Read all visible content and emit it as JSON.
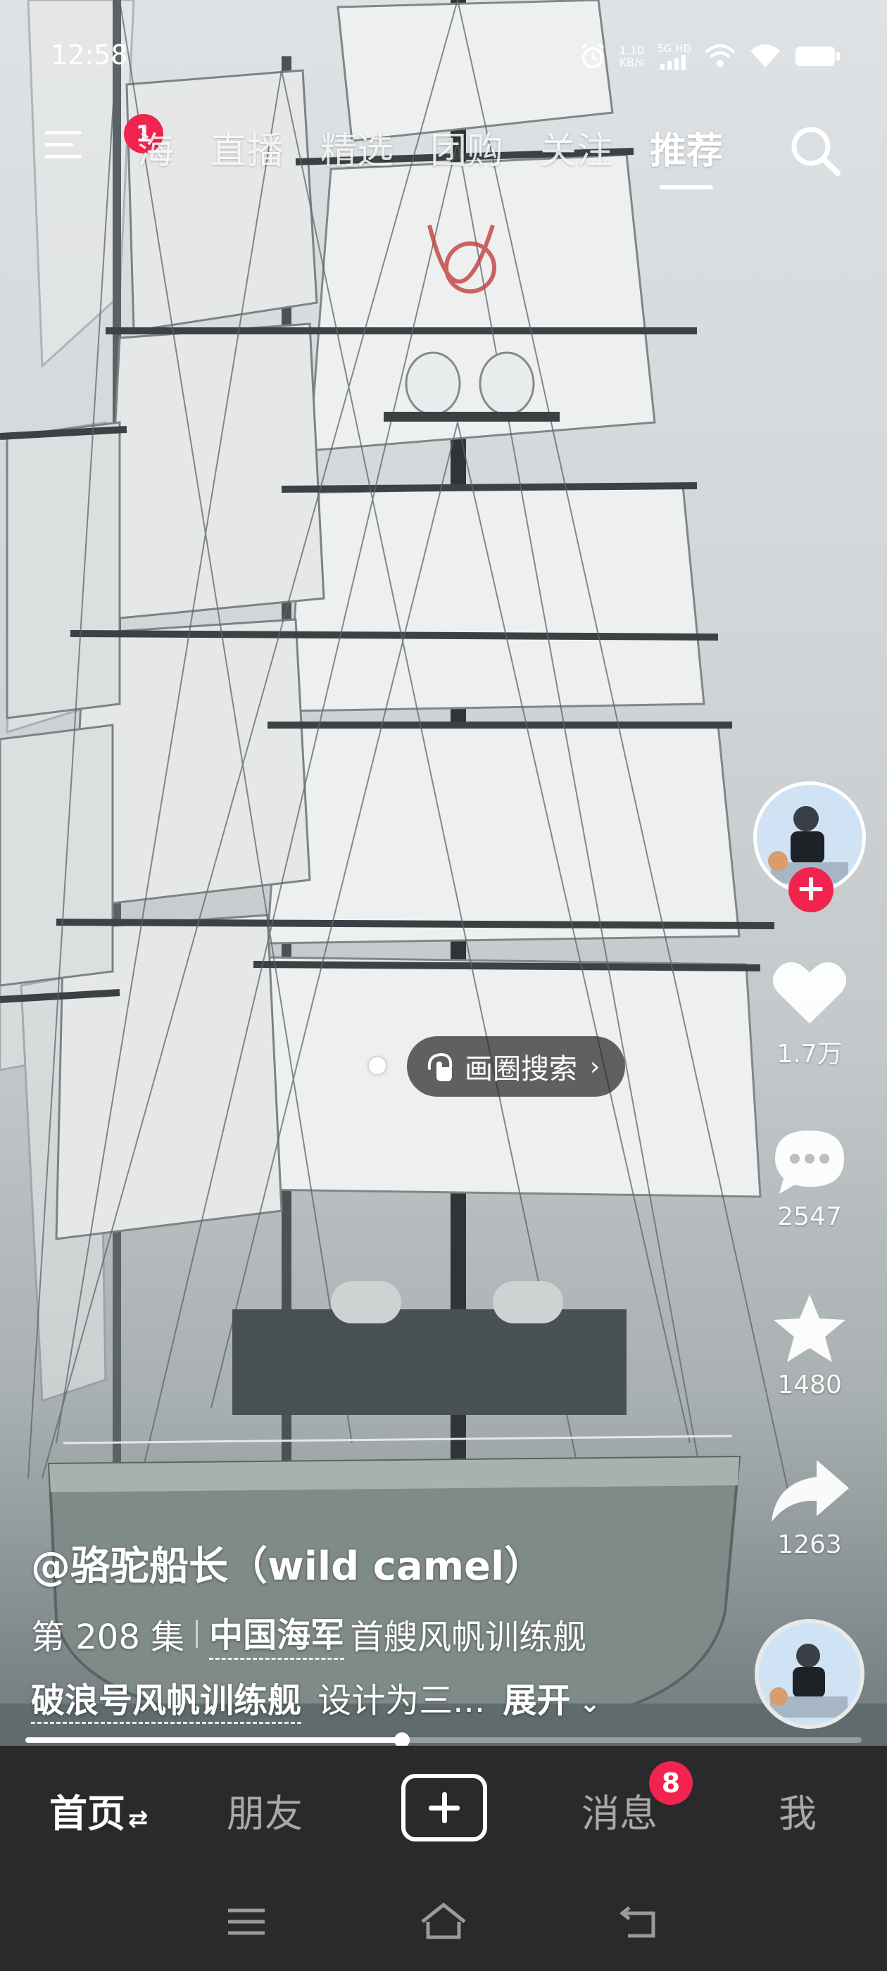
{
  "status_bar": {
    "time": "12:58",
    "speed_value": "1.10",
    "speed_unit": "KB/s",
    "network": "5G HD"
  },
  "top_nav": {
    "menu_badge": "1",
    "tabs": [
      "海",
      "直播",
      "精选",
      "团购",
      "关注",
      "推荐"
    ],
    "active_tab": "推荐"
  },
  "image_search": {
    "label": "画圈搜索"
  },
  "rail": {
    "likes": "1.7万",
    "comments": "2547",
    "favorites": "1480",
    "shares": "1263"
  },
  "caption": {
    "author": "@骆驼船长（wild camel）",
    "episode": "第 208 集",
    "tag": "中国海军",
    "line2_rest": "首艘风帆训练舰",
    "line3_tag": "破浪号风帆训练舰",
    "line3_rest": "设计为三...",
    "expand": "展开"
  },
  "progress": {
    "fraction": 0.45
  },
  "bottom_nav": {
    "home": "首页",
    "friends": "朋友",
    "messages": "消息",
    "messages_badge": "8",
    "me": "我"
  },
  "colors": {
    "accent": "#f0244e",
    "nav_bg": "#2a2a2a"
  }
}
